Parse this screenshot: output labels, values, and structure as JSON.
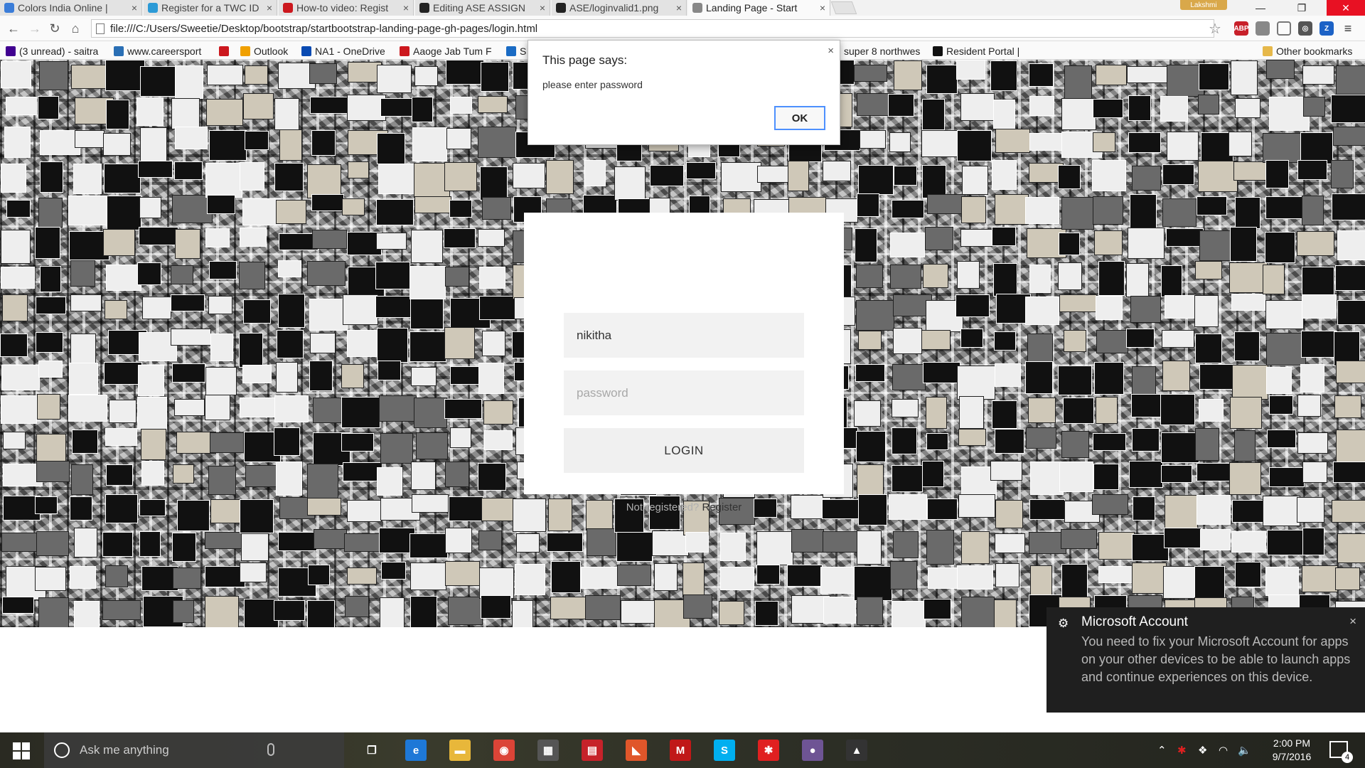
{
  "browser": {
    "tabs": [
      {
        "title": "Colors India Online |",
        "active": false,
        "icon": "colors-india-icon",
        "color": "#3b7dd8"
      },
      {
        "title": "Register for a TWC ID",
        "active": false,
        "icon": "twc-icon",
        "color": "#2c9ad6"
      },
      {
        "title": "How-to video: Regist",
        "active": false,
        "icon": "youtube-icon",
        "color": "#cc181e"
      },
      {
        "title": "Editing ASE ASSIGN",
        "active": false,
        "icon": "github-icon",
        "color": "#222222"
      },
      {
        "title": "ASE/loginvalid1.png",
        "active": false,
        "icon": "github-icon",
        "color": "#222222"
      },
      {
        "title": "Landing Page - Start",
        "active": true,
        "icon": "page-icon",
        "color": "#888888"
      }
    ],
    "profile_name": "Lakshmi",
    "address": "file:///C:/Users/Sweetie/Desktop/bootstrap/startbootstrap-landing-page-gh-pages/login.html",
    "bookmarks": [
      {
        "label": "(3 unread) - saitra",
        "icon": "yahoo-icon",
        "color": "#400090"
      },
      {
        "label": "www.careersport",
        "icon": "cp-icon",
        "color": "#2a6fb5"
      },
      {
        "label": "",
        "icon": "youtube-icon",
        "color": "#cc181e"
      },
      {
        "label": "Outlook",
        "icon": "outlook-icon",
        "color": "#f0a000"
      },
      {
        "label": "NA1 - OneDrive",
        "icon": "onedrive-icon",
        "color": "#094ab2"
      },
      {
        "label": "Aaoge Jab Tum F",
        "icon": "youtube-icon",
        "color": "#cc181e"
      },
      {
        "label": "S",
        "icon": "s-icon",
        "color": "#1a6bc4"
      },
      {
        "label": "super 8 northwes",
        "icon": "super8-icon",
        "color": "#c7c7c7"
      },
      {
        "label": "Resident Portal |",
        "icon": "resident-portal-icon",
        "color": "#111111"
      },
      {
        "label": "Other bookmarks",
        "icon": "folder-icon",
        "color": "#e6b84a"
      }
    ]
  },
  "alert": {
    "title": "This page says:",
    "message": "please enter password",
    "ok_label": "OK",
    "close_glyph": "×"
  },
  "login": {
    "username_value": "nikitha",
    "password_placeholder": "password",
    "button_label": "LOGIN",
    "register_prompt": "Not registered?",
    "register_link": "Register"
  },
  "toast": {
    "title": "Microsoft Account",
    "body": "You need to fix your Microsoft Account for apps on your other devices to be able to launch apps and continue experiences on this device.",
    "close_glyph": "×"
  },
  "taskbar": {
    "search_placeholder": "Ask me anything",
    "time": "2:00 PM",
    "date": "9/7/2016",
    "notification_count": "4",
    "pinned": [
      {
        "name": "task-view-icon",
        "glyph": "❐",
        "color": "transparent"
      },
      {
        "name": "edge-icon",
        "glyph": "e",
        "color": "#1e78d7"
      },
      {
        "name": "file-explorer-icon",
        "glyph": "▬",
        "color": "#e8b73a"
      },
      {
        "name": "chrome-icon",
        "glyph": "◉",
        "color": "#db4437"
      },
      {
        "name": "store-icon",
        "glyph": "▦",
        "color": "#555555"
      },
      {
        "name": "reader-icon",
        "glyph": "▤",
        "color": "#c6222a"
      },
      {
        "name": "app-icon",
        "glyph": "◣",
        "color": "#e0562a"
      },
      {
        "name": "mcafee-icon",
        "glyph": "M",
        "color": "#c01818"
      },
      {
        "name": "skype-icon",
        "glyph": "S",
        "color": "#00aff0"
      },
      {
        "name": "app-asterisk-icon",
        "glyph": "✱",
        "color": "#e02020"
      },
      {
        "name": "github-desktop-icon",
        "glyph": "●",
        "color": "#6e5494"
      },
      {
        "name": "photos-icon",
        "glyph": "▲",
        "color": "#333333"
      }
    ]
  },
  "colors": {
    "alert_button_border": "#4d90fe",
    "toast_bg": "#1f1f1f",
    "window_close": "#e81123"
  }
}
